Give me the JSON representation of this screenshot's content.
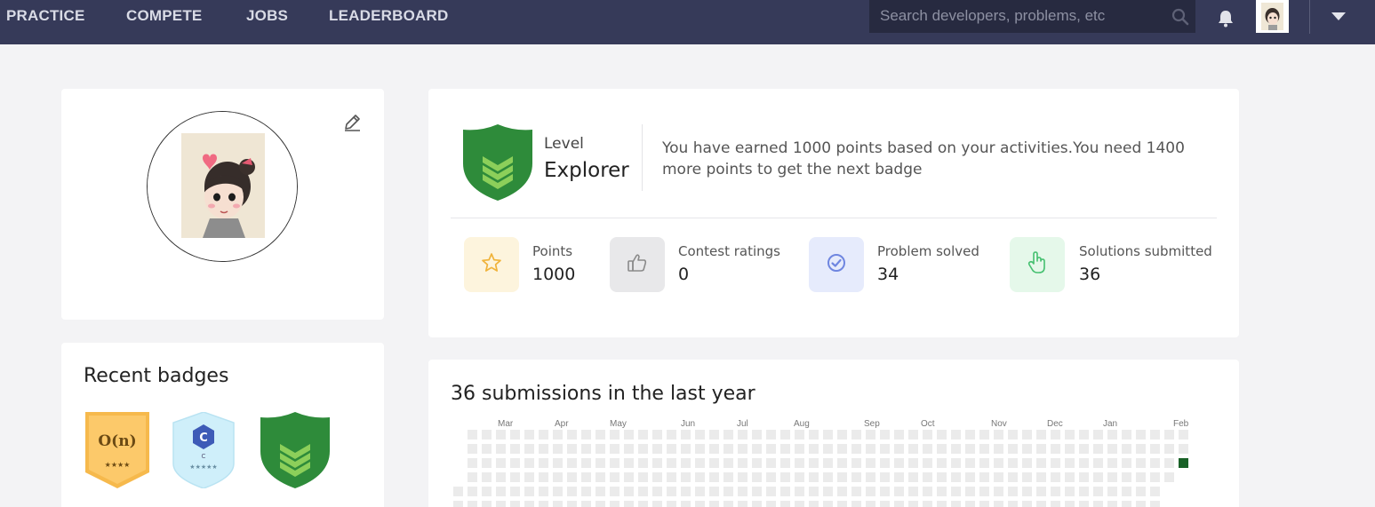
{
  "nav": {
    "items": [
      "PRACTICE",
      "COMPETE",
      "JOBS",
      "LEADERBOARD"
    ],
    "search_placeholder": "Search developers, problems, etc"
  },
  "profile": {
    "icons": [
      "edit-icon"
    ]
  },
  "level": {
    "label": "Level",
    "name": "Explorer",
    "message": "You have earned 1000 points based on your activities.You need 1400 more points to get the next badge"
  },
  "stats": [
    {
      "label": "Points",
      "value": "1000",
      "icon": "star-icon",
      "bg": "#fdf4dd",
      "color": "#f0b33a"
    },
    {
      "label": "Contest ratings",
      "value": "0",
      "icon": "thumbs-up-icon",
      "bg": "#e8e8ea",
      "color": "#8a8a8a"
    },
    {
      "label": "Problem solved",
      "value": "34",
      "icon": "check-circle-icon",
      "bg": "#e6ebfc",
      "color": "#6f86e0"
    },
    {
      "label": "Solutions submitted",
      "value": "36",
      "icon": "pointer-hand-icon",
      "bg": "#e5f8ea",
      "color": "#45c070"
    }
  ],
  "badges": {
    "title": "Recent badges",
    "items": [
      {
        "name": "big-o-badge",
        "text": "O(n)",
        "stars": "★★★★"
      },
      {
        "name": "c-language-badge",
        "text": "C",
        "sub": "C",
        "stars": "★★★★★"
      },
      {
        "name": "explorer-level-badge"
      }
    ]
  },
  "submissions": {
    "title": "36 submissions in the last year",
    "months": [
      "Mar",
      "Apr",
      "May",
      "Jun",
      "Jul",
      "Aug",
      "Sep",
      "Oct",
      "Nov",
      "Dec",
      "Jan",
      "Feb"
    ],
    "empty_color": "#ebebeb",
    "active_color": "#196127"
  },
  "colors": {
    "nav_bg": "#363a59",
    "shield_green": "#2e8b3a",
    "chevron_green": "#8ccf5a"
  }
}
